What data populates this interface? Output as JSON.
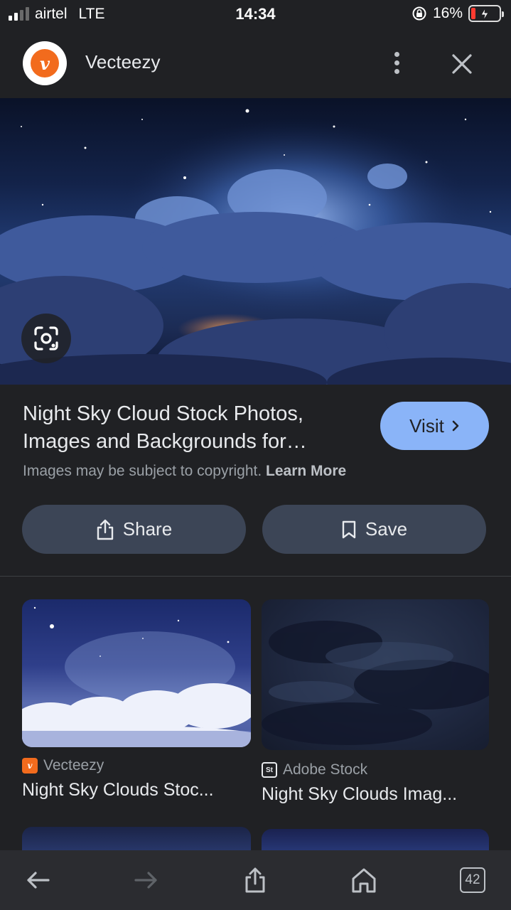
{
  "status_bar": {
    "carrier": "airtel",
    "network": "LTE",
    "time": "14:34",
    "battery": "16%"
  },
  "header": {
    "site_name": "Vecteezy",
    "logo_letter": "v"
  },
  "result": {
    "title": "Night Sky Cloud Stock Photos, Images and Backgrounds for…",
    "visit_label": "Visit",
    "copyright_text": "Images may be subject to copyright.",
    "learn_more": "Learn More"
  },
  "actions": {
    "share_label": "Share",
    "save_label": "Save"
  },
  "related": [
    {
      "source": "Vecteezy",
      "title": "Night Sky Clouds Stoc..."
    },
    {
      "source": "Adobe Stock",
      "title": "Night Sky Clouds Imag..."
    }
  ],
  "bottom_nav": {
    "tab_count": "42"
  },
  "colors": {
    "background": "#202124",
    "accent": "#8ab4f8",
    "button_bg": "#3c4556",
    "brand_vecteezy": "#f26b1d"
  },
  "icons": [
    "signal-icon",
    "battery-icon",
    "lock-rotation-icon",
    "more-vert-icon",
    "close-icon",
    "lens-icon",
    "chevron-right-icon",
    "share-icon",
    "bookmark-icon",
    "back-icon",
    "forward-icon",
    "home-icon",
    "tabs-icon"
  ]
}
